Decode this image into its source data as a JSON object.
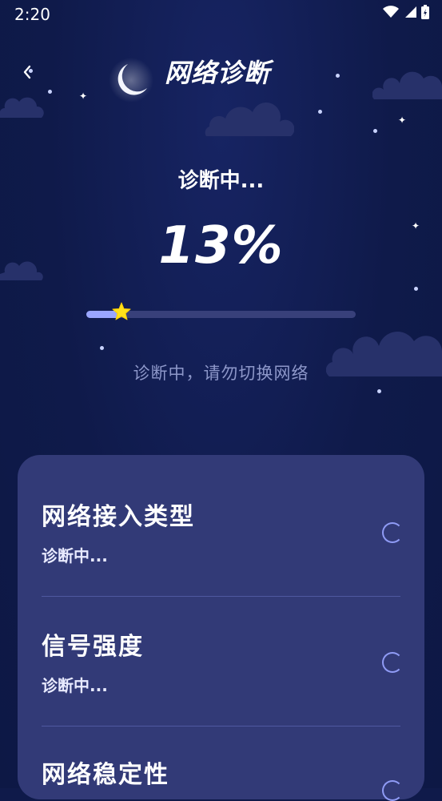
{
  "status_bar": {
    "time": "2:20"
  },
  "header": {
    "title": "网络诊断"
  },
  "progress": {
    "status": "诊断中...",
    "percent_text": "13%",
    "value": 0.13,
    "hint": "诊断中，请勿切换网络"
  },
  "items": [
    {
      "name": "网络接入类型",
      "state": "诊断中..."
    },
    {
      "name": "信号强度",
      "state": "诊断中..."
    },
    {
      "name": "网络稳定性",
      "state": ""
    }
  ],
  "colors": {
    "background": "#0f1a4a",
    "card": "#323a77",
    "accent": "#9aa6ff",
    "star": "#ffe11a"
  },
  "icons": {
    "back": "chevron-left-icon",
    "moon": "moon-icon",
    "knob": "star-icon",
    "loading": "spinner-icon"
  }
}
